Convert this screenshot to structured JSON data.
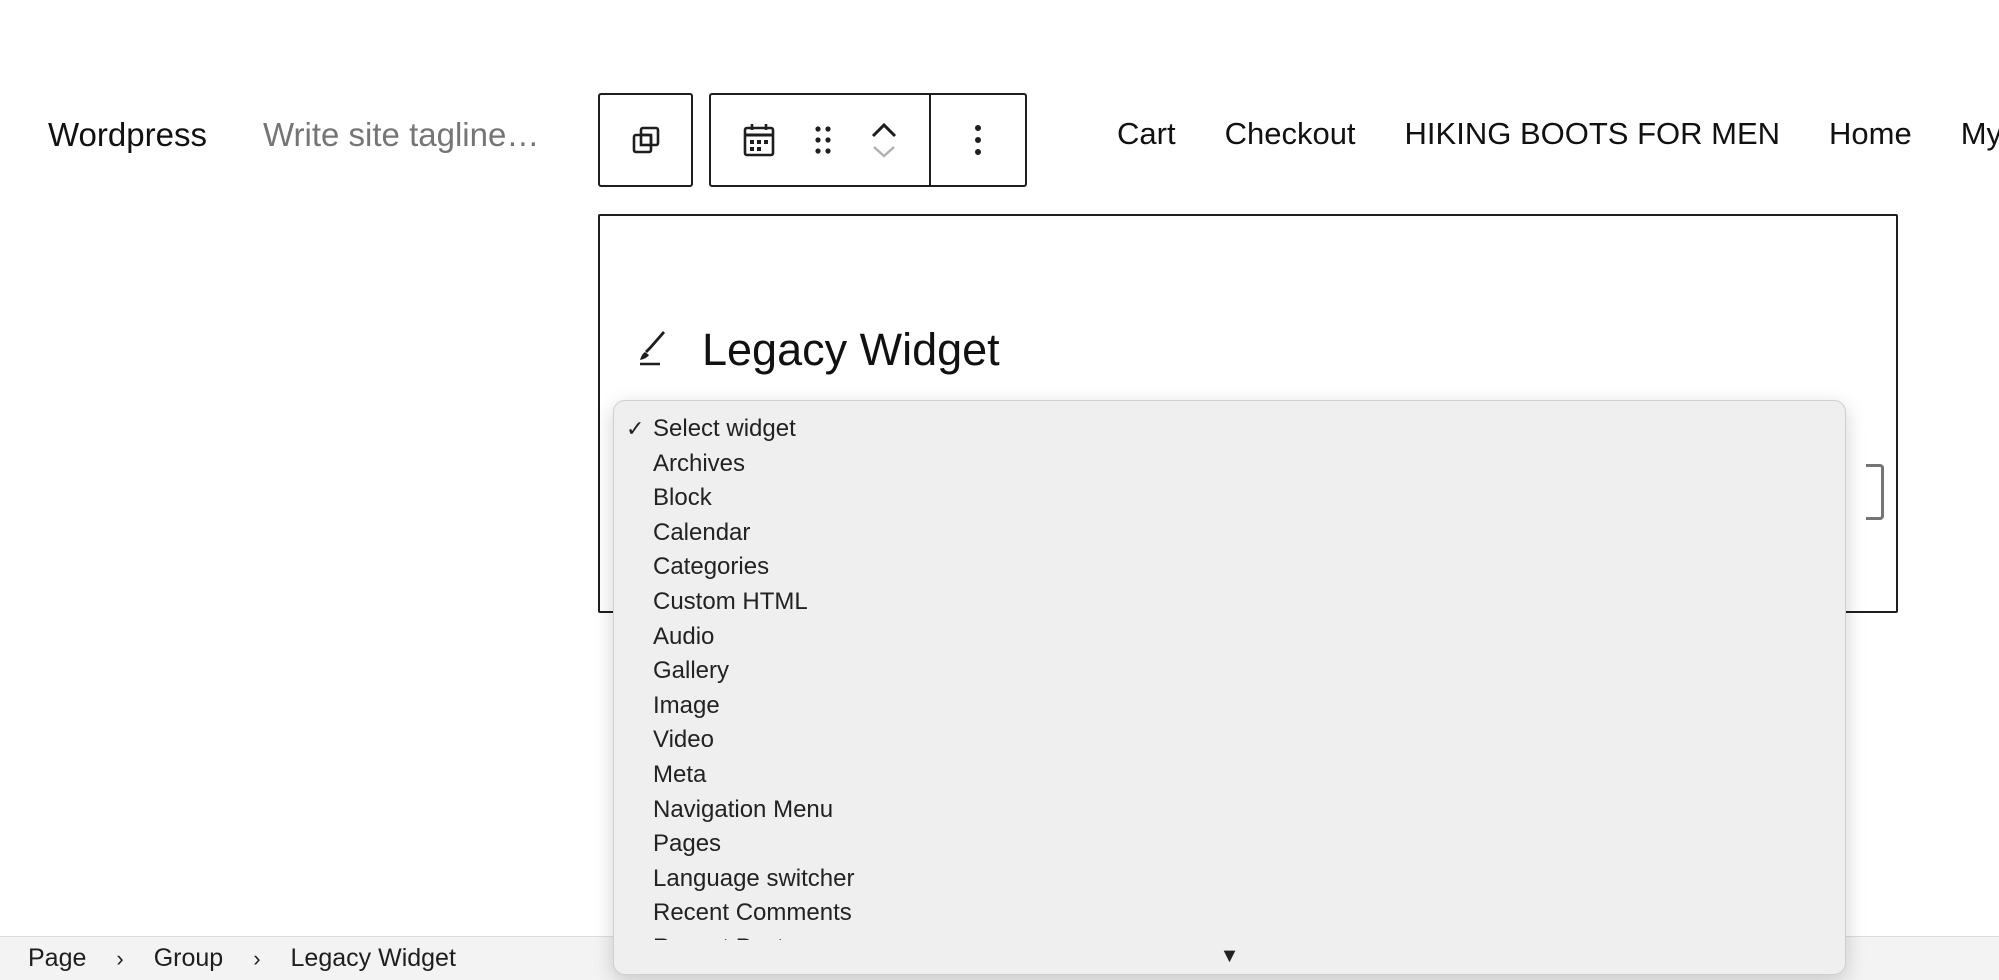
{
  "header": {
    "site_title": "Wordpress",
    "site_tagline_placeholder": "Write site tagline…"
  },
  "toolbar": {
    "parent_icon": "select-parent-icon",
    "block_icon": "calendar-icon",
    "drag_icon": "drag-handle-icon",
    "move_up_icon": "chevron-up-icon",
    "move_down_icon": "chevron-down-icon",
    "more_icon": "more-vertical-icon"
  },
  "nav": {
    "items": [
      {
        "label": "Cart"
      },
      {
        "label": "Checkout"
      },
      {
        "label": "HIKING BOOTS FOR MEN"
      },
      {
        "label": "Home"
      },
      {
        "label": "My a"
      }
    ]
  },
  "widget": {
    "icon": "brush-icon",
    "title": "Legacy Widget"
  },
  "dropdown": {
    "selected_mark": "✓",
    "options": [
      {
        "label": "Select widget",
        "selected": true
      },
      {
        "label": "Archives"
      },
      {
        "label": "Block"
      },
      {
        "label": "Calendar"
      },
      {
        "label": "Categories"
      },
      {
        "label": "Custom HTML"
      },
      {
        "label": "Audio"
      },
      {
        "label": "Gallery"
      },
      {
        "label": "Image"
      },
      {
        "label": "Video"
      },
      {
        "label": "Meta"
      },
      {
        "label": "Navigation Menu"
      },
      {
        "label": "Pages"
      },
      {
        "label": "Language switcher"
      },
      {
        "label": "Recent Comments"
      },
      {
        "label": "Recent Posts"
      }
    ],
    "scroll_arrow": "▼"
  },
  "breadcrumb": {
    "items": [
      {
        "label": "Page"
      },
      {
        "label": "Group"
      },
      {
        "label": "Legacy Widget"
      }
    ],
    "separator": "›"
  },
  "colors": {
    "border": "#1e1e1e",
    "muted_text": "#757575",
    "dropdown_bg": "#efefef",
    "footer_bg": "#f3f3f3"
  }
}
